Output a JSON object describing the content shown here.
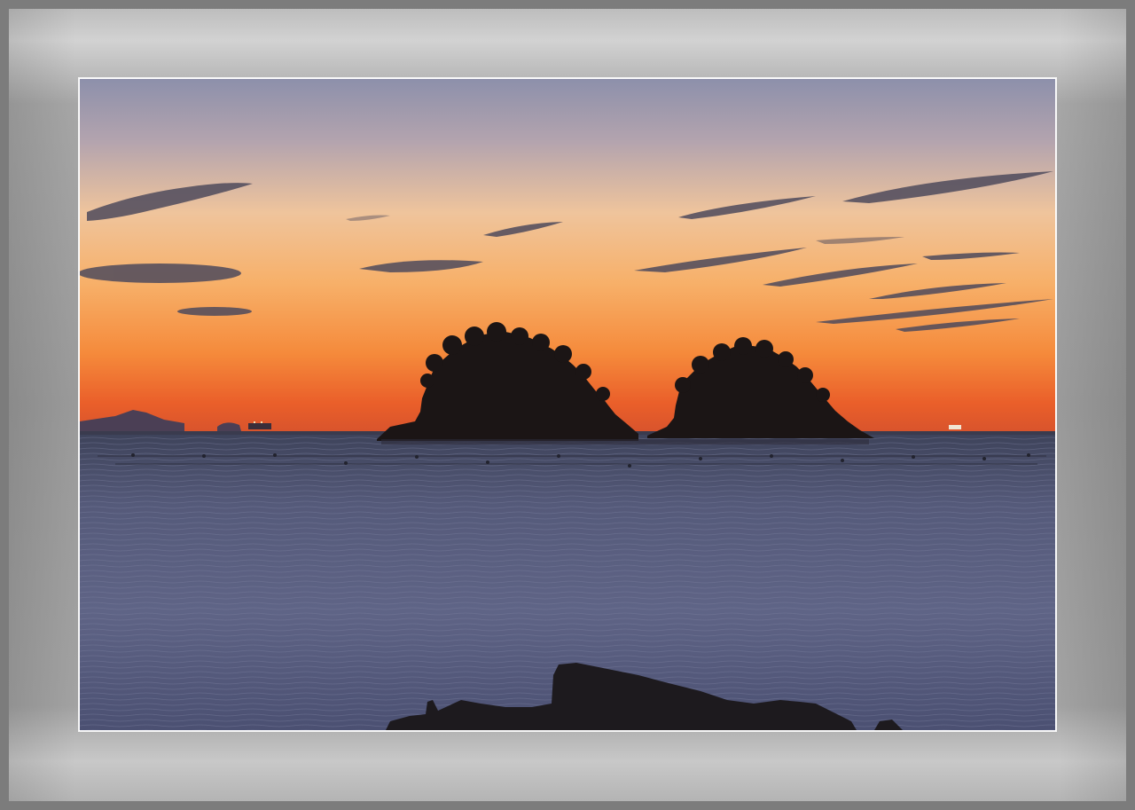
{
  "scene": {
    "subject": "twin-islands-sunset",
    "colors": {
      "sky_top": "#8b8fa8",
      "sky_mid": "#f2b07a",
      "sky_horizon": "#f06a2a",
      "sea": "#4a5070",
      "silhouette": "#1a1414",
      "frame": "#9a9a9a"
    }
  }
}
